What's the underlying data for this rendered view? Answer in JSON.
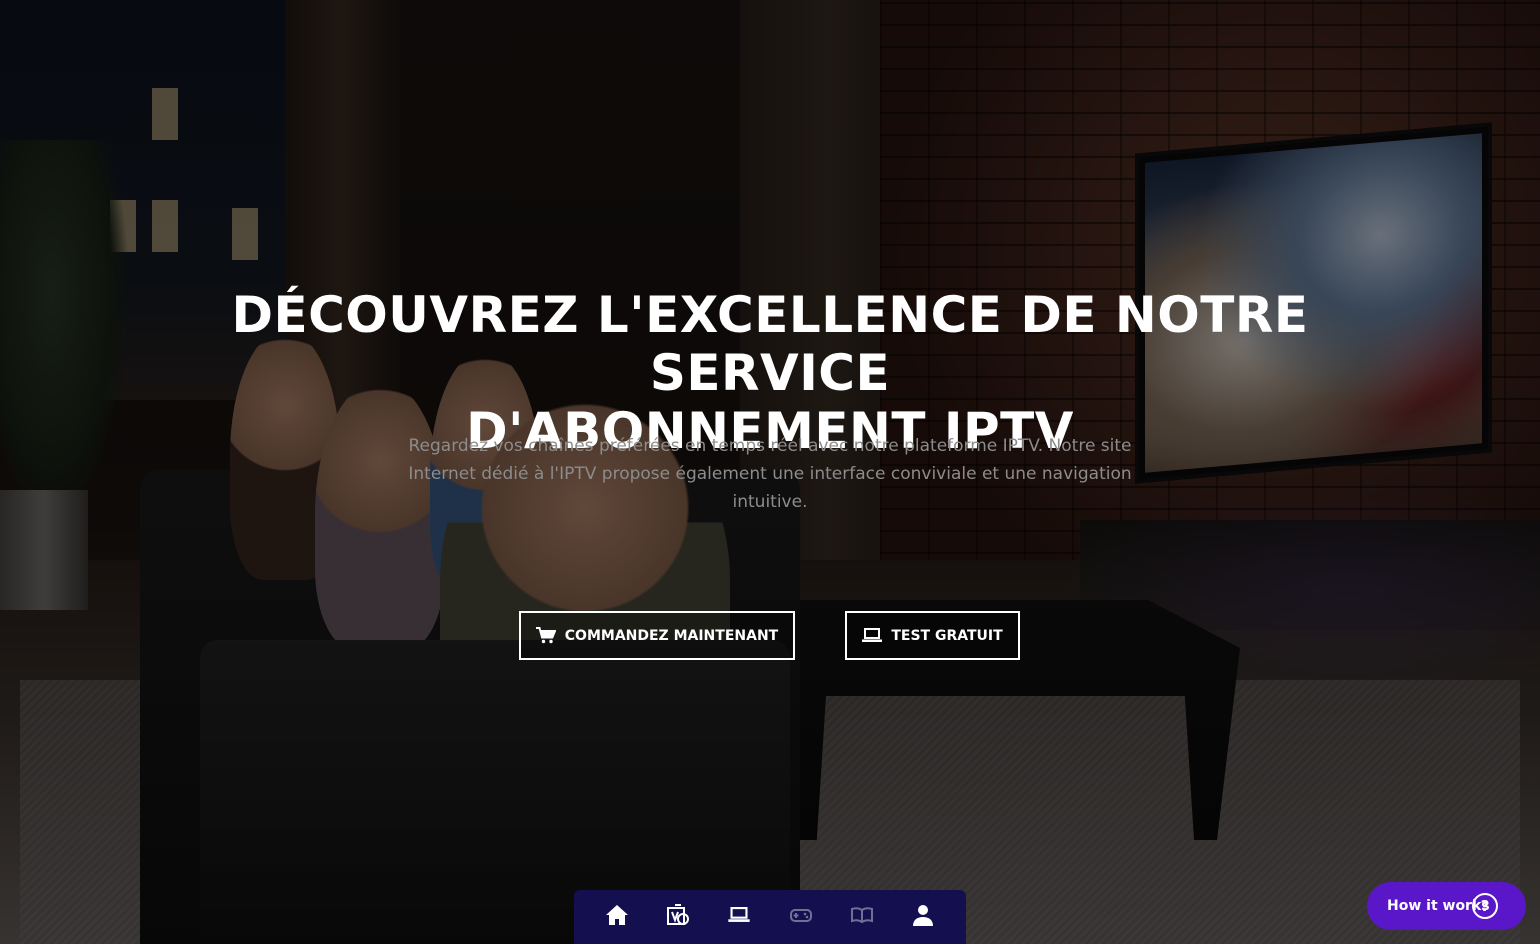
{
  "hero": {
    "title_line1": "DÉCOUVREZ L'EXCELLENCE DE NOTRE SERVICE",
    "title_line2": "D'ABONNEMENT IPTV",
    "subtitle": "Regardez vos chaînes préférées en temps réel avec notre plateforme IPTV. Notre site Internet dédié à l'IPTV propose également une interface conviviale et une navigation intuitive."
  },
  "buttons": {
    "order": {
      "label": "COMMANDEZ MAINTENANT",
      "icon": "cart-icon"
    },
    "trial": {
      "label": "TEST GRATUIT",
      "icon": "laptop-icon"
    }
  },
  "dock": {
    "items": [
      {
        "icon": "home-icon",
        "active": true
      },
      {
        "icon": "vod-icon",
        "active": true
      },
      {
        "icon": "laptop-icon",
        "active": true
      },
      {
        "icon": "gamepad-icon",
        "active": false
      },
      {
        "icon": "book-icon",
        "active": false
      },
      {
        "icon": "user-icon",
        "active": true
      }
    ]
  },
  "help": {
    "label": "How it works",
    "icon": "question-icon"
  },
  "colors": {
    "dock_bg": "#140f4e",
    "help_bg": "#5a16c9",
    "title": "#ffffff",
    "subtitle": "#8c8c8c"
  }
}
